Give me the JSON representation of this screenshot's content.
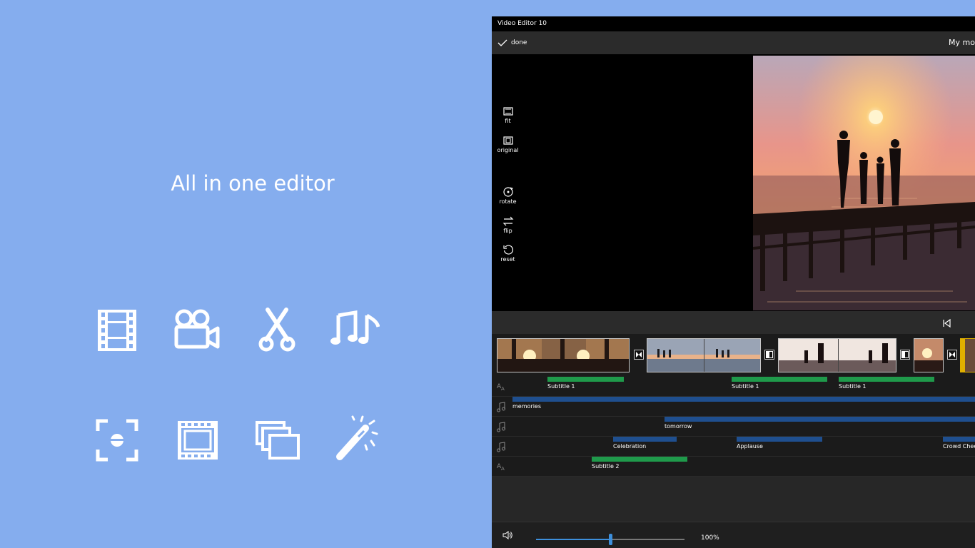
{
  "marketing": {
    "headline": "All in one editor",
    "feature_icons": [
      "film-strip-icon",
      "video-camera-icon",
      "scissors-icon",
      "music-notes-icon",
      "screenshot-capture-icon",
      "video-frame-icon",
      "overlay-layers-icon",
      "magic-wand-icon"
    ],
    "icon_color": "#ffffff"
  },
  "app": {
    "window_title": "Video Editor 10",
    "toolbar": {
      "done_label": "done",
      "project_title": "My mo"
    },
    "tools": [
      {
        "label": "fit",
        "icon": "fit-icon"
      },
      {
        "label": "original",
        "icon": "original-size-icon"
      },
      {
        "label": "rotate",
        "icon": "rotate-icon"
      },
      {
        "label": "flip",
        "icon": "flip-icon"
      },
      {
        "label": "reset",
        "icon": "reset-icon"
      }
    ],
    "tracks": {
      "subtitle_1": [
        "Subtitle 1",
        "Subtitle 1",
        "Subtitle 1"
      ],
      "music_1": [
        "memories"
      ],
      "music_2": [
        "tomorrow"
      ],
      "sfx": [
        "Celebration",
        "Applause",
        "Crowd Chee"
      ],
      "subtitle_2": [
        "Subtitle 2"
      ]
    },
    "volume": {
      "percent_label": "100%",
      "level": 0.5
    },
    "colors": {
      "background": "#85adee",
      "subtitle_bar": "#1f9a4b",
      "audio_bar": "#1f4f8f",
      "accent": "#3d8fdc"
    }
  }
}
